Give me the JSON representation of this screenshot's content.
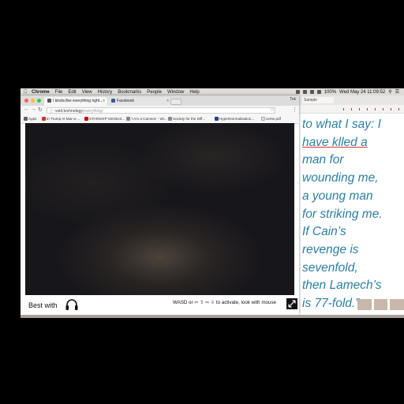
{
  "menubar": {
    "items": [
      "Chrome",
      "File",
      "Edit",
      "View",
      "History",
      "Bookmarks",
      "People",
      "Window",
      "Help"
    ],
    "clock": "Wed May 24  11:09:52",
    "battery": "100%"
  },
  "chrome": {
    "tabs": [
      {
        "label": "I kinda like everything right...",
        "favicon_color": "#555555",
        "active": true
      },
      {
        "label": "Facebook",
        "favicon_color": "#3b5998",
        "active": false
      }
    ],
    "profile": "Tok",
    "url_host": "void.technology",
    "url_path": "/everything/",
    "bookmarks": [
      {
        "label": "Apps",
        "color": "#5f6368"
      },
      {
        "label": "In Trump At Mar-a-...",
        "color": "#c53929"
      },
      {
        "label": "STARSHIP GENIUS...",
        "color": "#cc0000"
      },
      {
        "label": "'I Am a Camera' - Wi...",
        "color": "#888888"
      },
      {
        "label": "Society for the Diff...",
        "color": "#888888"
      },
      {
        "label": "HyperNormalisation...",
        "color": "#1c4587"
      },
      {
        "label": "cerse.pdf",
        "color": "#dddddd"
      }
    ]
  },
  "page": {
    "best_with": "Best with",
    "hint": "WASD or ⇦ ⇧ ⇨ ⇩ to activate, look with mouse"
  },
  "poem": {
    "lines": [
      "to what I say: I",
      "have klled a",
      "man for",
      "wounding me,",
      "a young man",
      "for striking me.",
      "If Cain’s",
      "revenge is",
      "sevenfold,",
      "then Lamech’s",
      "is 77-fold.”"
    ]
  },
  "bgwin": {
    "tab_label": "Sample"
  },
  "colors": {
    "poem_blue": "#2b7fa3",
    "mac_red": "#fc605c",
    "mac_yellow": "#fdbc40",
    "mac_green": "#34c84a"
  }
}
